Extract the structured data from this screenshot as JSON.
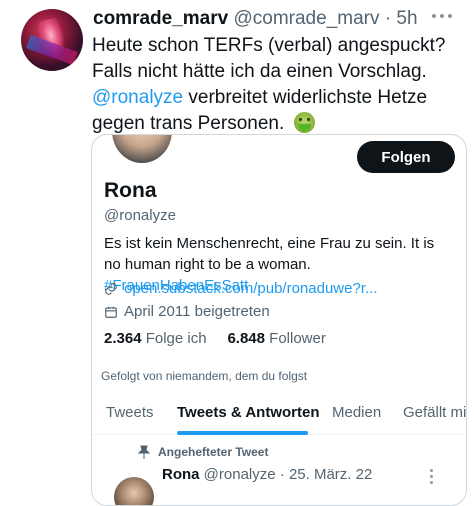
{
  "tweet": {
    "display_name": "comrade_marv",
    "handle": "@comrade_marv",
    "separator": "·",
    "time": "5h",
    "line1": "Heute schon TERFs (verbal) angespuckt?",
    "line2": "Falls nicht hätte ich da einen Vorschlag.",
    "mention": "@ronalyze",
    "line3_rest": " verbreitet widerlichste Hetze",
    "line4": "gegen trans Personen. ",
    "emoji": "nauseated-face-icon"
  },
  "profile_card": {
    "follow_label": "Folgen",
    "name": "Rona",
    "handle": "@ronalyze",
    "bio_text": "Es ist kein Menschenrecht, eine Frau zu sein. It is no human right to be a woman. ",
    "bio_hashtag": "#FrauenHabenEsSatt",
    "link": "open.substack.com/pub/ronaduwe?r...",
    "joined": "April 2011 beigetreten",
    "following_count": "2.364",
    "following_label": "Folge ich",
    "followers_count": "6.848",
    "followers_label": "Follower",
    "followed_by": "Gefolgt von niemandem, dem du folgst",
    "tabs": [
      "Tweets",
      "Tweets & Antworten",
      "Medien",
      "Gefällt mir"
    ],
    "active_tab": "Tweets & Antworten",
    "pinned_label": "Angehefteter Tweet",
    "pinned_name": "Rona",
    "pinned_handle": "@ronalyze",
    "pinned_time": "25. März. 22"
  },
  "colors": {
    "accent": "#1d9bf0",
    "text": "#0f1419",
    "secondary": "#536471",
    "border": "#cfd9de"
  }
}
